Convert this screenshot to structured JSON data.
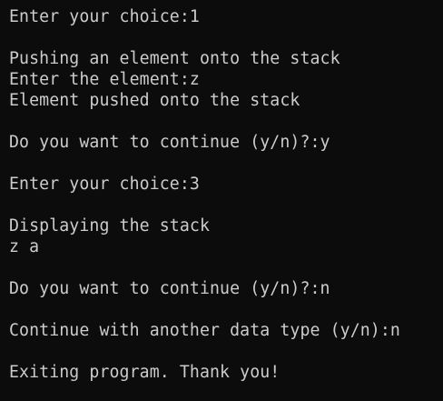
{
  "terminal": {
    "lines": [
      "Enter your choice:1",
      "",
      "Pushing an element onto the stack",
      "Enter the element:z",
      "Element pushed onto the stack",
      "",
      "Do you want to continue (y/n)?:y",
      "",
      "Enter your choice:3",
      "",
      "Displaying the stack",
      "z a",
      "",
      "Do you want to continue (y/n)?:n",
      "",
      "Continue with another data type (y/n):n",
      "",
      "Exiting program. Thank you!"
    ],
    "colors": {
      "background": "#0c0c0c",
      "text": "#cccccc"
    }
  }
}
